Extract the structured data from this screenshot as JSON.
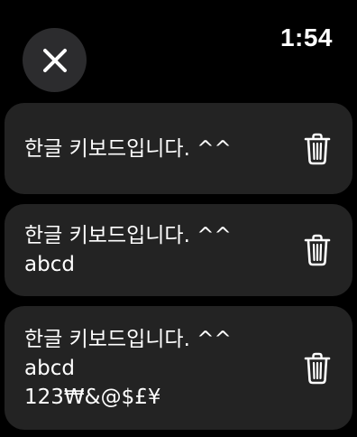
{
  "status": {
    "time": "1:54"
  },
  "items": [
    {
      "text": "한글 키보드입니다. ^^"
    },
    {
      "text": "한글 키보드입니다. ^^\nabcd"
    },
    {
      "text": "한글 키보드입니다. ^^\nabcd\n123₩&@$£¥"
    }
  ],
  "icons": {
    "close": "close-icon",
    "trash": "trash-icon"
  },
  "colors": {
    "background": "#000000",
    "row_background": "#232323",
    "close_button_background": "#2c2c2e",
    "text": "#ffffff"
  }
}
